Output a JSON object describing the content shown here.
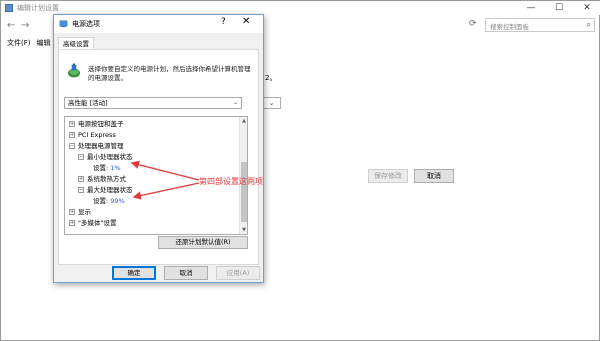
{
  "background_window": {
    "title": "编辑计划设置",
    "search_placeholder": "搜索控制面板",
    "menu": [
      "文件(F)",
      "编辑"
    ],
    "partial_text": "2。",
    "buttons": {
      "save": "保存修改",
      "cancel": "取消"
    }
  },
  "window_controls": {
    "minimize": "—",
    "maximize": "☐",
    "close": "✕"
  },
  "dialog": {
    "title": "电源选项",
    "help": "?",
    "close": "✕",
    "tab": "高级设置",
    "intro_lines": [
      "选择你要自定义的电源计划，然后选择你希望计算机管理",
      "的电源设置。"
    ],
    "plan_select": "高性能 [活动]",
    "tree": [
      {
        "label": "电源按钮和盖子",
        "expander": "+"
      },
      {
        "label": "PCI Express",
        "expander": "+"
      },
      {
        "label": "处理器电源管理",
        "expander": "−"
      },
      {
        "label": "最小处理器状态",
        "expander": "−"
      },
      {
        "label": "设置:",
        "value": "1%"
      },
      {
        "label": "系统散热方式",
        "expander": "+"
      },
      {
        "label": "最大处理器状态",
        "expander": "−"
      },
      {
        "label": "设置:",
        "value": "99%"
      },
      {
        "label": "显示",
        "expander": "+"
      },
      {
        "label": "\"多媒体\"设置",
        "expander": "+"
      }
    ],
    "restore_button": "还原计划默认值(R)",
    "ok": "确定",
    "cancel": "取消",
    "apply": "应用(A)"
  },
  "annotation": "第四部设置这两项",
  "colors": {
    "annotation": "#e23a3a",
    "value_link": "#2b5fd9",
    "dialog_border": "#6f9dd2"
  }
}
